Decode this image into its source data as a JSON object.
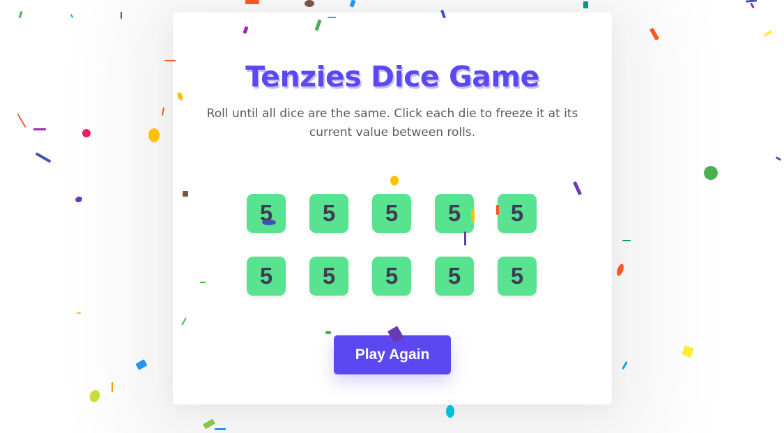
{
  "game": {
    "title": "Tenzies Dice Game",
    "instructions": "Roll until all dice are the same. Click each die to freeze it at its current value between rolls.",
    "dice": [
      5,
      5,
      5,
      5,
      5,
      5,
      5,
      5,
      5,
      5
    ],
    "play_again_label": "Play Again",
    "state": "won"
  },
  "colors": {
    "accent": "#5b48f0",
    "die_held": "#59e391",
    "die_text": "#3d3d55",
    "instructions_text": "#5a5a5a"
  },
  "effects": {
    "confetti": true
  }
}
